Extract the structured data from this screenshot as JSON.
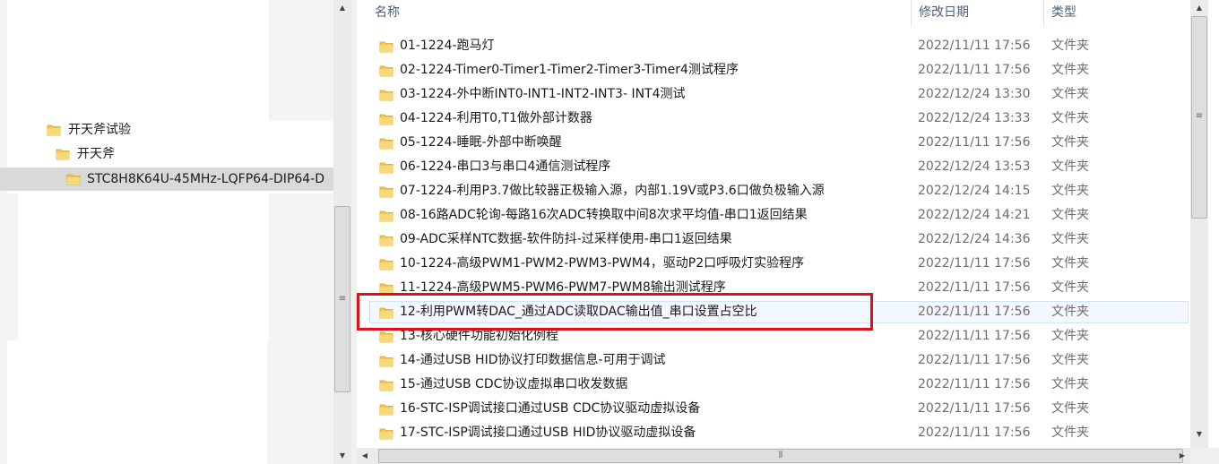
{
  "nav": {
    "items": [
      {
        "label": "开天斧试验"
      },
      {
        "label": "开天斧"
      },
      {
        "label": "STC8H8K64U-45MHz-LQFP64-DIP64-D"
      }
    ]
  },
  "columns": {
    "name": "名称",
    "date": "修改日期",
    "type": "类型"
  },
  "icons": {
    "folder": "folder-icon",
    "scroll_up": "▲",
    "scroll_down": "▼",
    "scroll_left": "◀",
    "scroll_right": "▶",
    "grip_v": "≡",
    "grip_h": "⦀",
    "sort": "ˇ"
  },
  "colors": {
    "highlight": "#e0101a",
    "folder": "#f1c652",
    "selected_row": "#f2f8fd"
  },
  "rows": [
    {
      "name": "01-1224-跑马灯",
      "date": "2022/11/11 17:56",
      "type": "文件夹"
    },
    {
      "name": "02-1224-Timer0-Timer1-Timer2-Timer3-Timer4测试程序",
      "date": "2022/11/11 17:56",
      "type": "文件夹"
    },
    {
      "name": "03-1224-外中断INT0-INT1-INT2-INT3- INT4测试",
      "date": "2022/12/24 13:30",
      "type": "文件夹"
    },
    {
      "name": "04-1224-利用T0,T1做外部计数器",
      "date": "2022/12/24 13:33",
      "type": "文件夹"
    },
    {
      "name": "05-1224-睡眠-外部中断唤醒",
      "date": "2022/11/11 17:56",
      "type": "文件夹"
    },
    {
      "name": "06-1224-串口3与串口4通信测试程序",
      "date": "2022/12/24 13:53",
      "type": "文件夹"
    },
    {
      "name": "07-1224-利用P3.7做比较器正极输入源，内部1.19V或P3.6口做负极输入源",
      "date": "2022/12/24 14:15",
      "type": "文件夹"
    },
    {
      "name": "08-16路ADC轮询-每路16次ADC转换取中间8次求平均值-串口1返回结果",
      "date": "2022/12/24 14:21",
      "type": "文件夹"
    },
    {
      "name": "09-ADC采样NTC数据-软件防抖-过采样使用-串口1返回结果",
      "date": "2022/12/24 14:36",
      "type": "文件夹"
    },
    {
      "name": "10-1224-高级PWM1-PWM2-PWM3-PWM4，驱动P2口呼吸灯实验程序",
      "date": "2022/11/11 17:56",
      "type": "文件夹"
    },
    {
      "name": "11-1224-高级PWM5-PWM6-PWM7-PWM8输出测试程序",
      "date": "2022/11/11 17:56",
      "type": "文件夹"
    },
    {
      "name": "12-利用PWM转DAC_通过ADC读取DAC输出值_串口设置占空比",
      "date": "2022/11/11 17:56",
      "type": "文件夹"
    },
    {
      "name": "13-核心硬件功能初始化例程",
      "date": "2022/11/11 17:56",
      "type": "文件夹"
    },
    {
      "name": "14-通过USB HID协议打印数据信息-可用于调试",
      "date": "2022/11/11 17:56",
      "type": "文件夹"
    },
    {
      "name": "15-通过USB CDC协议虚拟串口收发数据",
      "date": "2022/11/11 17:56",
      "type": "文件夹"
    },
    {
      "name": "16-STC-ISP调试接口通过USB CDC协议驱动虚拟设备",
      "date": "2022/11/11 17:56",
      "type": "文件夹"
    },
    {
      "name": "17-STC-ISP调试接口通过USB HID协议驱动虚拟设备",
      "date": "2022/11/11 17:56",
      "type": "文件夹"
    }
  ]
}
